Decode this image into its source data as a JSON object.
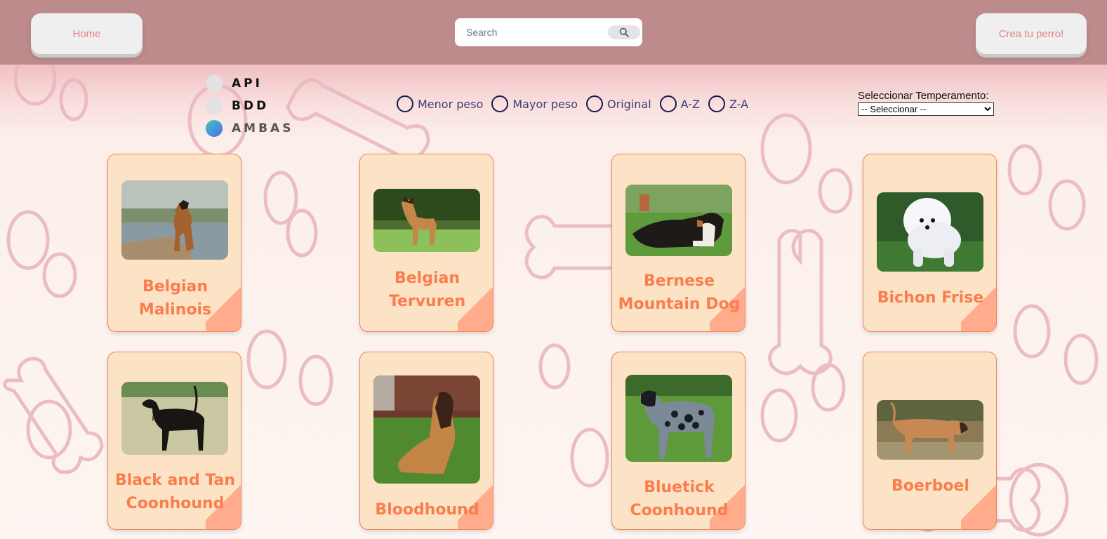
{
  "header": {
    "home_label": "Home",
    "search_placeholder": "Search",
    "create_label": "Crea tu perro!"
  },
  "source_filter": {
    "options": [
      {
        "label": "API",
        "active": false
      },
      {
        "label": "BDD",
        "active": false
      },
      {
        "label": "AMBAS",
        "active": true
      }
    ]
  },
  "sort_options": [
    "Menor peso",
    "Mayor peso",
    "Original",
    "A-Z",
    "Z-A"
  ],
  "temperament": {
    "label": "Seleccionar Temperamento:",
    "selected": "-- Seleccionar --"
  },
  "breeds": [
    {
      "name": "Belgian\nMalinois"
    },
    {
      "name": "Belgian\nTervuren"
    },
    {
      "name": "Bernese\nMountain Dog"
    },
    {
      "name": "Bichon Frise"
    },
    {
      "name": "Black and Tan\nCoonhound"
    },
    {
      "name": "Bloodhound"
    },
    {
      "name": "Bluetick\nCoonhound"
    },
    {
      "name": "Boerboel"
    }
  ],
  "colors": {
    "header_bg": "#bd8b8c",
    "card_bg": "#fde3c6",
    "card_title": "#fa7d4d",
    "accent": "#e87f7f"
  }
}
